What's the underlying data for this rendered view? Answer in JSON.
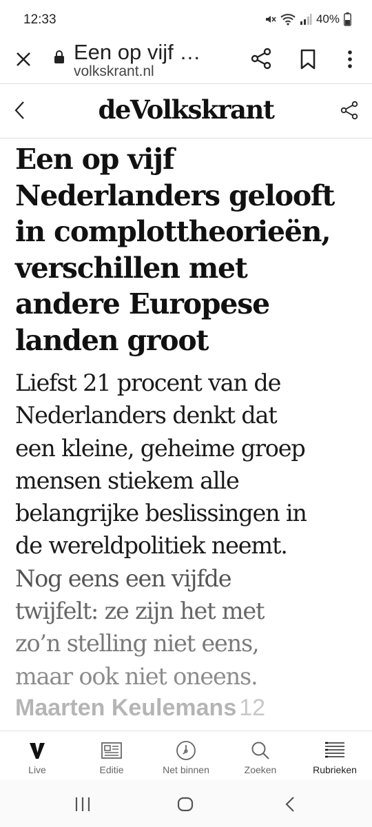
{
  "status_bar": {
    "time": "12:33",
    "battery": "40%",
    "icons": [
      "mute-icon",
      "wifi-icon",
      "signal-icon",
      "battery-icon"
    ]
  },
  "browser": {
    "page_title": "Een op vijf …",
    "domain": "volkskrant.nl",
    "icons": [
      "close-icon",
      "lock-icon",
      "share-icon",
      "bookmark-icon",
      "more-vertical-icon"
    ]
  },
  "site_header": {
    "logo": "deVolkskrant",
    "icons": [
      "chevron-left-icon",
      "share-icon"
    ]
  },
  "article": {
    "headline": "Een op vijf Nederlanders gelooft in complottheorieën, verschillen met andere Europese landen groot",
    "intro_lines": [
      "Liefst 21 procent van de",
      "Nederlanders denkt dat",
      "een kleine, geheime groep",
      "mensen stiekem alle",
      "belangrijke beslissingen in",
      "de wereldpolitiek neemt.",
      "Nog eens een vijfde",
      "twijfelt: ze zijn het met",
      "zo’n stelling niet eens,",
      "maar ook niet oneens."
    ],
    "author": "Maarten Keulemans",
    "author_suffix": "12"
  },
  "bottom_nav": [
    {
      "label": "Live",
      "icon": "v-logo-icon"
    },
    {
      "label": "Editie",
      "icon": "newspaper-icon"
    },
    {
      "label": "Net binnen",
      "icon": "clock-icon"
    },
    {
      "label": "Zoeken",
      "icon": "search-icon"
    },
    {
      "label": "Rubrieken",
      "icon": "menu-list-icon"
    }
  ],
  "android_nav": [
    "recent-apps-icon",
    "home-icon",
    "back-icon"
  ],
  "colors": {
    "text": "#111111",
    "intro_fade": [
      "#1a1a1a",
      "#1a1a1a",
      "#1a1a1a",
      "#1a1a1a",
      "#1a1a1a",
      "#1a1a1a",
      "#555555",
      "#666666",
      "#7a7a7a",
      "#8c8c8c"
    ],
    "author": "#b5b5b5"
  }
}
